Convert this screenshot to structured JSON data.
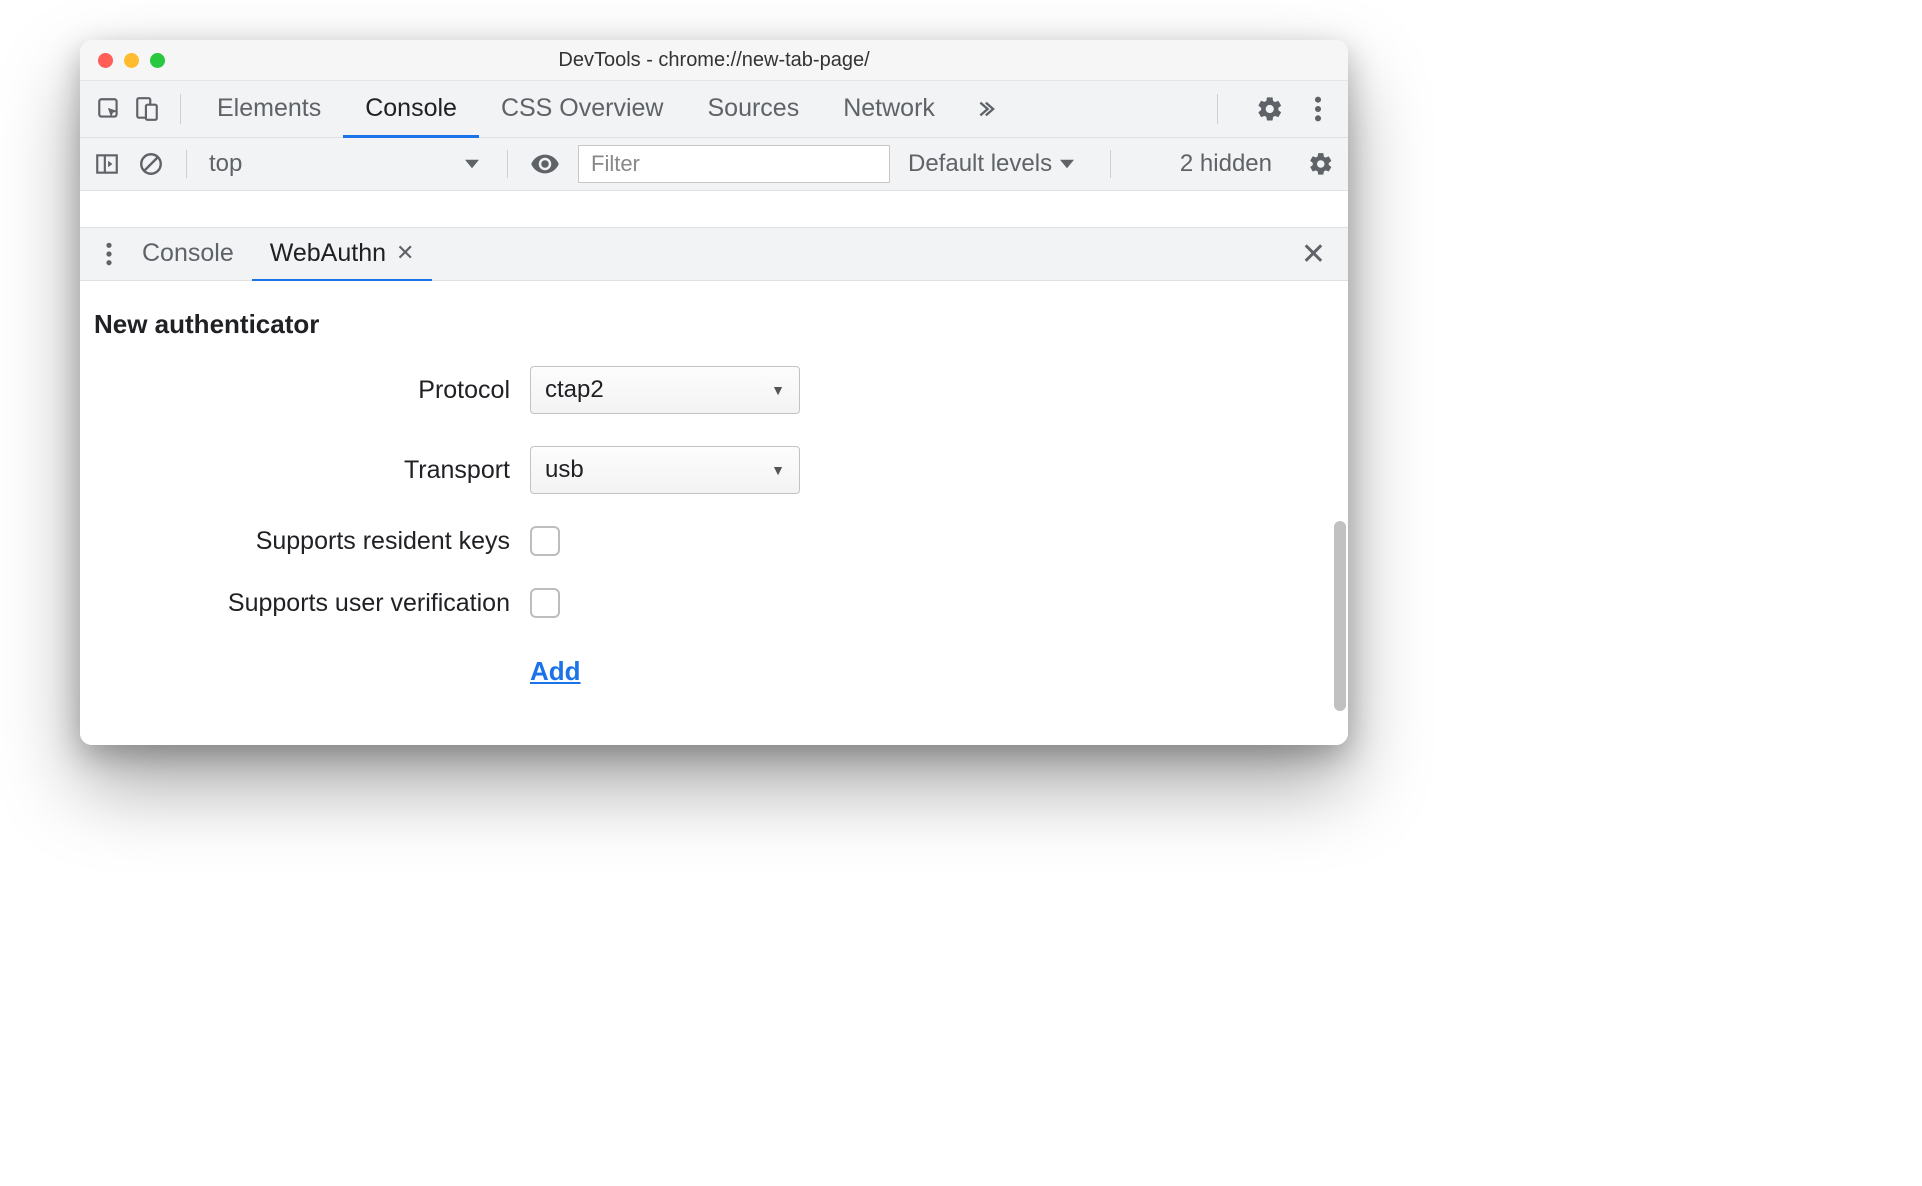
{
  "window": {
    "title": "DevTools - chrome://new-tab-page/"
  },
  "main_tabs": {
    "elements": "Elements",
    "console": "Console",
    "css_overview": "CSS Overview",
    "sources": "Sources",
    "network": "Network"
  },
  "console_toolbar": {
    "context": "top",
    "filter_placeholder": "Filter",
    "levels": "Default levels",
    "hidden": "2 hidden"
  },
  "drawer_tabs": {
    "console": "Console",
    "webauthn": "WebAuthn"
  },
  "webauthn": {
    "heading": "New authenticator",
    "labels": {
      "protocol": "Protocol",
      "transport": "Transport",
      "resident_keys": "Supports resident keys",
      "user_verification": "Supports user verification"
    },
    "values": {
      "protocol": "ctap2",
      "transport": "usb",
      "resident_keys_checked": false,
      "user_verification_checked": false
    },
    "add": "Add"
  }
}
